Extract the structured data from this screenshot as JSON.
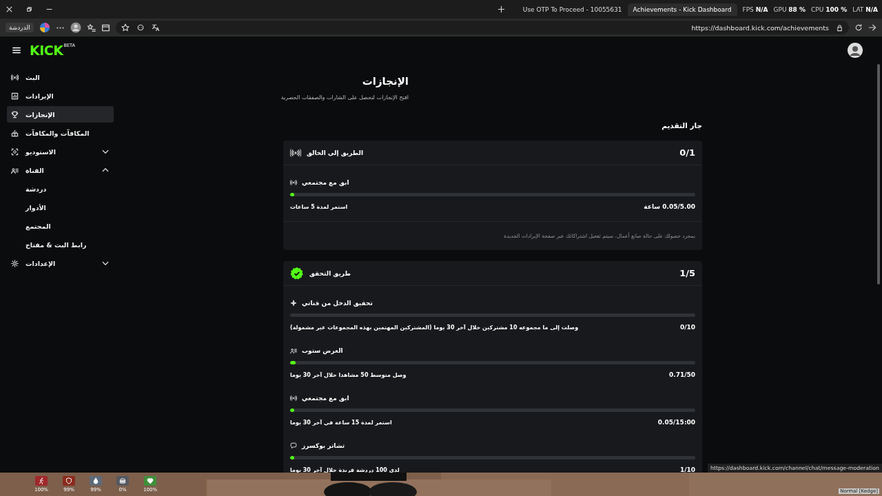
{
  "browser": {
    "tabs": [
      {
        "title": "Achievements - Kick Dashboard",
        "selected": true
      },
      {
        "title": "Use OTP To Proceed - 10055631",
        "selected": false
      }
    ],
    "overlay_stats": [
      "LAT **N/A**",
      "CPU **100 %**",
      "GPU **88 %**",
      "FPS **N/A**"
    ],
    "chat_button": "الدردشة",
    "url": "https://dashboard.kick.com/achievements",
    "status_url": "https://dashboard.kick.com/channel/chat/message-moderation"
  },
  "logo": {
    "text": "KICK",
    "badge": "BETA"
  },
  "sidebar": {
    "items": [
      {
        "label": "البث",
        "kind": "link",
        "selected": false
      },
      {
        "label": "الإيرادات",
        "kind": "link",
        "selected": false
      },
      {
        "label": "الإنجازات",
        "kind": "link",
        "selected": true
      },
      {
        "label": "المكافآت والمكافآت",
        "kind": "link",
        "selected": false
      },
      {
        "label": "الاستوديو",
        "kind": "group",
        "expanded": false,
        "selected": false
      },
      {
        "label": "القناة",
        "kind": "group",
        "expanded": true,
        "selected": false,
        "children": [
          {
            "label": "دردشة",
            "selected": false
          },
          {
            "label": "الأدوار",
            "selected": false
          },
          {
            "label": "المجتمع",
            "selected": false
          },
          {
            "label": "رابط البث & مفتاح",
            "selected": false
          }
        ]
      },
      {
        "label": "الإعدادات",
        "kind": "group",
        "expanded": false,
        "selected": false
      }
    ]
  },
  "page": {
    "title": "الإنجازات",
    "subtitle": "افتح الإنجازات لتحصل على الشارات والصفقات الحصرية",
    "section": "جار التقديم"
  },
  "cards": [
    {
      "title": "الطريق إلى الخالق",
      "verified": false,
      "count": "0/1",
      "goals": [
        {
          "title": "ابق مع مجتمعي",
          "level": 0.01,
          "description": "استمر لمدة 5 ساعات",
          "value": "0.05/5.00 ساعة"
        }
      ],
      "note": "بمجرد حصولك على حالة صانع أعمال، سيتم تفعيل اشتراكاتك عبر صفحة الإيرادات الجديدة"
    },
    {
      "title": "طريق التحقق",
      "verified": true,
      "count": "1/5",
      "goals": [
        {
          "title": "تحقيق الدخل من قناتي",
          "description": "وصلت إلى ما مجموعه 10 مشتركين خلال آخر 30 يوما (المشتركين المهتمين بهذه المجموعات غير مشمولة)",
          "value": "0/10"
        },
        {
          "title": "العرض ستوب",
          "level": 0.014,
          "description": "وصل متوسط 50 مشاهدا خلال آخر 30 يوما",
          "value": "0.71/50"
        },
        {
          "title": "ابق مع مجتمعي",
          "level": 0.003,
          "description": "استمر لمدة 15 ساعة في آخر 30 يوما",
          "value": "0.05/15:00"
        },
        {
          "title": "تشاتر بوكسرز",
          "level": 0.01,
          "description": "لدي 100 دردشة فريدة خلال آخر 30 يوما",
          "value": "1/10"
        }
      ]
    }
  ],
  "game_hud": {
    "stats": [
      {
        "value": "100%",
        "color": "#3f8f3a"
      },
      {
        "value": "0%",
        "color": "#55595f"
      },
      {
        "value": "99%",
        "color": "#5d6a78"
      },
      {
        "value": "99%",
        "color": "#8a2b1e"
      },
      {
        "value": "100%",
        "color": "#a0282b"
      }
    ],
    "mode": "Normal [Kedge]"
  }
}
